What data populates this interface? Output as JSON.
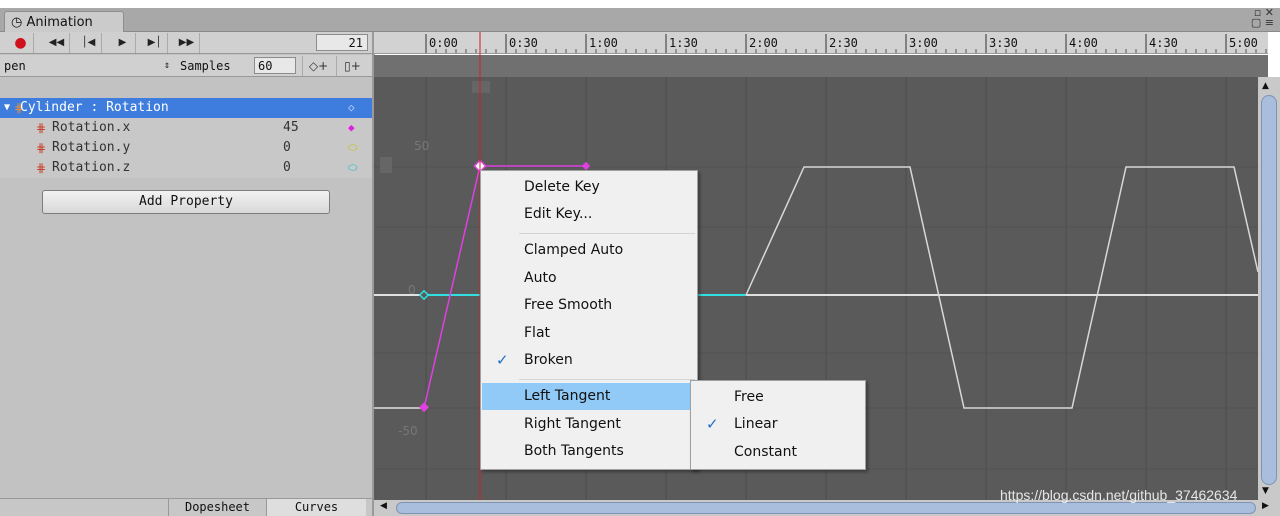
{
  "window": {
    "tab_title": "Animation",
    "tab_icon": "clock-icon",
    "buttons": [
      "maximize-icon",
      "close-icon",
      "lock-icon",
      "menu-icon"
    ]
  },
  "toolbar": {
    "record_icon": "record-icon",
    "first_key_icon": "first-key-icon",
    "prev_key_icon": "prev-key-icon",
    "play_icon": "play-icon",
    "next_key_icon": "next-key-icon",
    "last_key_icon": "last-key-icon",
    "frame": "21",
    "clip": "pen",
    "samples_label": "Samples",
    "samples_value": "60",
    "add_keyframe_icon": "add-keyframe-icon",
    "add_event_icon": "add-event-icon"
  },
  "properties": [
    {
      "name": "Cylinder : Rotation",
      "value": "",
      "marker_color": "#bfd4ff",
      "selected": true
    },
    {
      "name": "Rotation.x",
      "value": "45",
      "marker_color": "#e020e0",
      "selected": false
    },
    {
      "name": "Rotation.y",
      "value": "0",
      "marker_color": "#e0e020",
      "selected": false
    },
    {
      "name": "Rotation.z",
      "value": "0",
      "marker_color": "#20e0e0",
      "selected": false
    }
  ],
  "add_property_label": "Add Property",
  "bottom_tabs": {
    "dopesheet": "Dopesheet",
    "curves": "Curves",
    "active": "Curves"
  },
  "ruler": {
    "labels": [
      "0:00",
      "0:30",
      "1:00",
      "1:30",
      "2:00",
      "2:30",
      "3:00",
      "3:30",
      "4:00",
      "4:30",
      "5:00"
    ]
  },
  "curve_axis": {
    "labels": [
      "50",
      "0",
      "-50"
    ]
  },
  "curve_colors": {
    "x": "#e040e0",
    "y": "#e0e040",
    "z": "#30e0e0",
    "other": "#e0e0e0",
    "playhead": "#d02020"
  },
  "context_menu": {
    "items": [
      {
        "label": "Delete Key",
        "checked": false,
        "submenu": false,
        "highlighted": false
      },
      {
        "label": "Edit Key...",
        "checked": false,
        "submenu": false,
        "highlighted": false
      },
      {
        "label": "Clamped Auto",
        "checked": false,
        "submenu": false,
        "highlighted": false
      },
      {
        "label": "Auto",
        "checked": false,
        "submenu": false,
        "highlighted": false
      },
      {
        "label": "Free Smooth",
        "checked": false,
        "submenu": false,
        "highlighted": false
      },
      {
        "label": "Flat",
        "checked": false,
        "submenu": false,
        "highlighted": false
      },
      {
        "label": "Broken",
        "checked": true,
        "submenu": false,
        "highlighted": false
      },
      {
        "label": "Left Tangent",
        "checked": false,
        "submenu": true,
        "highlighted": true
      },
      {
        "label": "Right Tangent",
        "checked": false,
        "submenu": true,
        "highlighted": false
      },
      {
        "label": "Both Tangents",
        "checked": false,
        "submenu": true,
        "highlighted": false
      }
    ]
  },
  "submenu": {
    "items": [
      {
        "label": "Free",
        "checked": false
      },
      {
        "label": "Linear",
        "checked": true
      },
      {
        "label": "Constant",
        "checked": false
      }
    ]
  },
  "watermark": "https://blog.csdn.net/github_37462634"
}
